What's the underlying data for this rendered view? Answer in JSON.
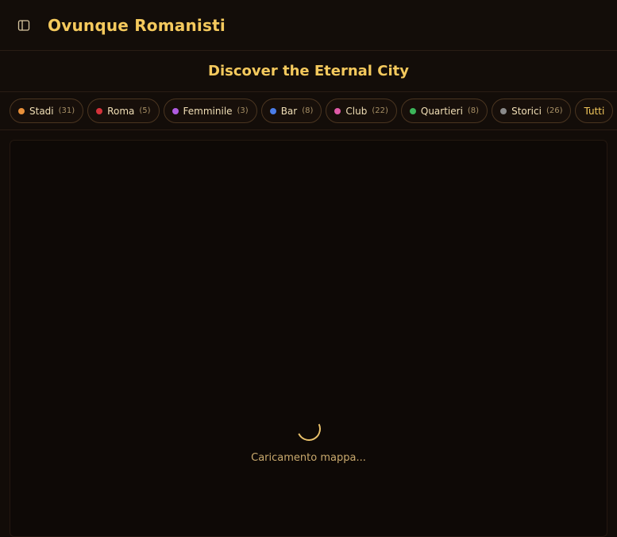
{
  "app": {
    "title": "Ovunque Romanisti"
  },
  "header": {
    "subtitle": "Discover the Eternal City"
  },
  "filters": [
    {
      "label": "Stadi",
      "count": "(31)",
      "color": "#e8903a"
    },
    {
      "label": "Roma",
      "count": "(5)",
      "color": "#d4323a"
    },
    {
      "label": "Femminile",
      "count": "(3)",
      "color": "#b05ce0"
    },
    {
      "label": "Bar",
      "count": "(8)",
      "color": "#4a7de8"
    },
    {
      "label": "Club",
      "count": "(22)",
      "color": "#e05aa8"
    },
    {
      "label": "Quartieri",
      "count": "(8)",
      "color": "#3cb55a"
    },
    {
      "label": "Storici",
      "count": "(26)",
      "color": "#8a8a8a"
    }
  ],
  "filter_all_label": "Tutti",
  "map": {
    "loading_text": "Caricamento mappa..."
  },
  "icons": {
    "sidebar_toggle": "sidebar-panel-icon"
  }
}
